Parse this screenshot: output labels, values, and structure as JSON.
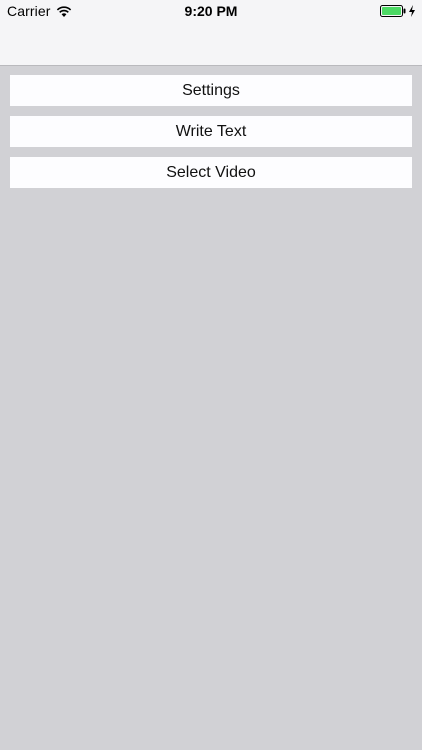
{
  "status_bar": {
    "carrier": "Carrier",
    "time": "9:20 PM",
    "battery_level": 1.0,
    "charging": true,
    "accent_battery_color": "#4cd964",
    "icons": [
      "wifi-icon",
      "battery-icon",
      "charging-icon"
    ]
  },
  "menu": {
    "items": [
      {
        "label": "Settings"
      },
      {
        "label": "Write Text"
      },
      {
        "label": "Select Video"
      }
    ]
  },
  "colors": {
    "background": "#d1d1d5",
    "nav_bar": "#f5f5f7",
    "button_bg": "#fdfdff"
  }
}
